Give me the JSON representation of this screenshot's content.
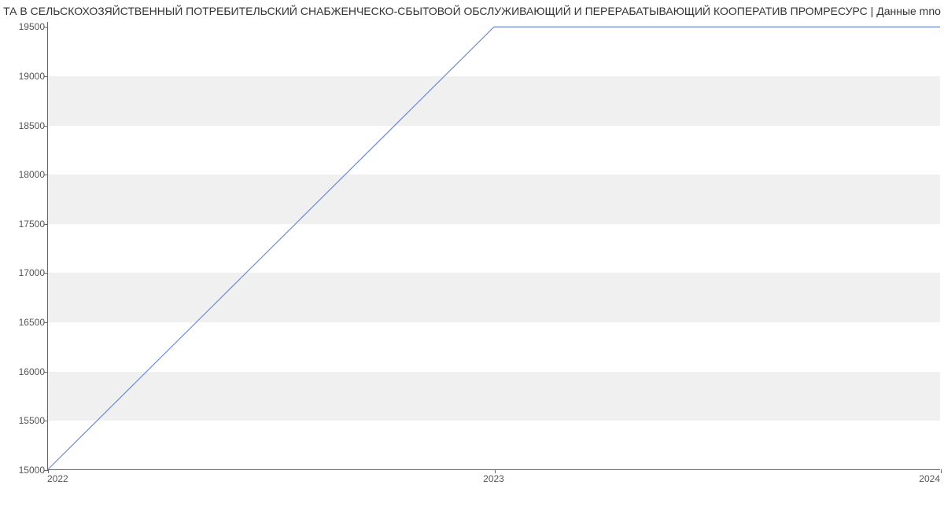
{
  "chart_data": {
    "type": "line",
    "title": "ТА В СЕЛЬСКОХОЗЯЙСТВЕННЫЙ ПОТРЕБИТЕЛЬСКИЙ СНАБЖЕНЧЕСКО-СБЫТОВОЙ ОБСЛУЖИВАЮЩИЙ И ПЕРЕРАБАТЫВАЮЩИЙ КООПЕРАТИВ  ПРОМРЕСУРС | Данные mno",
    "x": [
      2022,
      2023,
      2024
    ],
    "series": [
      {
        "name": "value",
        "values": [
          15000,
          19500,
          19500
        ]
      }
    ],
    "xlabel": "",
    "ylabel": "",
    "xticks": [
      2022,
      2023,
      2024
    ],
    "yticks": [
      15000,
      15500,
      16000,
      16500,
      17000,
      17500,
      18000,
      18500,
      19000,
      19500
    ],
    "ylim": [
      15000,
      19550
    ],
    "xlim": [
      2022,
      2024
    ]
  }
}
